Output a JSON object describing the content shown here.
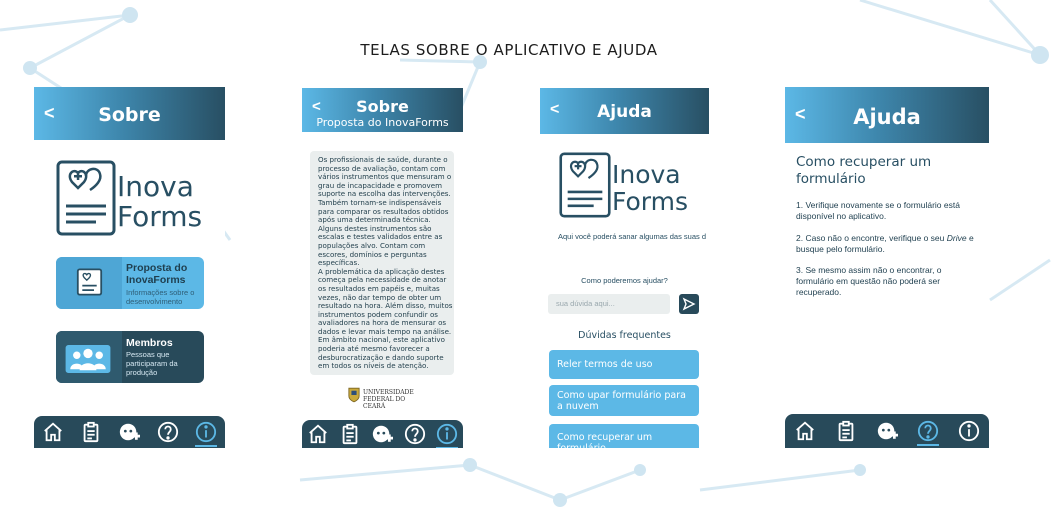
{
  "page_title": "TELAS SOBRE O APLICATIVO E AJUDA",
  "colors": {
    "accent": "#5cb8e6",
    "dark": "#284a5a",
    "panel": "#eaeeee"
  },
  "logo": {
    "line1": "Inova",
    "line2": "Forms"
  },
  "screen1": {
    "back": "<",
    "title": "Sobre",
    "card1": {
      "title": "Proposta do InovaForms",
      "subtitle": "Informações sobre o desenvolvimento"
    },
    "card2": {
      "title": "Membros",
      "subtitle": "Pessoas que participaram da produção"
    }
  },
  "screen2": {
    "back": "<",
    "title": "Sobre",
    "subtitle": "Proposta do InovaForms",
    "body": [
      "Os profissionais de saúde, durante o",
      "processo de avaliação, contam com",
      "vários instrumentos que mensuram o",
      "grau de incapacidade e promovem",
      "suporte na escolha das intervenções.",
      "Também tornam-se indispensáveis",
      "para comparar os resultados obtidos",
      "após uma determinada técnica.",
      "Alguns destes instrumentos são",
      "escalas e testes validados entre as",
      "populações alvo. Contam com",
      "escores, domínios e perguntas",
      "específicas.",
      "A problemática da aplicação destes",
      "começa pela necessidade de anotar",
      "os resultados em papéis e, muitas",
      "vezes, não dar tempo de obter um",
      "resultado na hora. Além disso, muitos",
      "instrumentos podem confundir os",
      "avaliadores na hora de mensurar os",
      "dados e levar mais tempo na análise.",
      "Em âmbito nacional, este aplicativo",
      "poderia até mesmo favorecer a",
      "desburocratização e dando suporte",
      "em todos os níveis de atenção."
    ],
    "university": {
      "line1": "UNIVERSIDADE",
      "line2": "FEDERAL DO CEARÁ"
    }
  },
  "screen3": {
    "back": "<",
    "title": "Ajuda",
    "tagline": "Aqui você poderá sanar algumas das suas d",
    "question": "Como poderemos ajudar?",
    "search_placeholder": "sua dúvida aqui...",
    "faq_title": "Dúvidas frequentes",
    "faq": [
      "Reler termos de uso",
      "Como upar formulário para a nuvem",
      "Como recuperar um formulário"
    ]
  },
  "screen4": {
    "back": "<",
    "title": "Ajuda",
    "heading": "Como recuperar um formulário",
    "step1": {
      "text": "1. Verifique novamente se o formulário está disponível no aplicativo."
    },
    "step2": {
      "a": "2. Caso não o encontre, verifique o seu ",
      "em": "Drive",
      "b": " e busque pelo formulário."
    },
    "step3": {
      "text": "3. Se mesmo assim não o encontrar, o formulário em questão não poderá ser recuperado."
    }
  },
  "nav_icons": [
    "home-icon",
    "clipboard-icon",
    "profile-add-icon",
    "help-icon",
    "info-icon"
  ],
  "nav_active": {
    "screen1": "info-icon",
    "screen2": "info-icon",
    "screen3": "help-icon",
    "screen4": "help-icon"
  }
}
